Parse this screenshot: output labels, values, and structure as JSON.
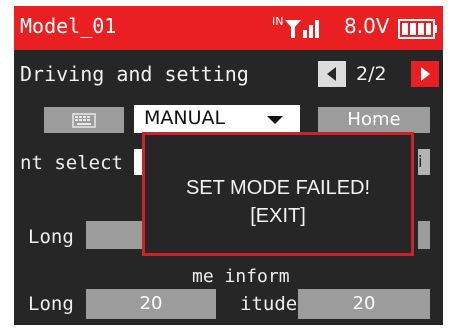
{
  "status_bar": {
    "model_name": "Model_01",
    "signal_prefix": "IN",
    "voltage": "8.0V",
    "signal_icon": "signal-bars-icon",
    "battery_icon": "battery-icon"
  },
  "header": {
    "title": "Driving and setting",
    "page": "2/2",
    "prev_icon": "arrow-left-icon",
    "next_icon": "arrow-right-icon"
  },
  "controls": {
    "keyboard_icon": "keyboard-icon",
    "mode_value": "MANUAL",
    "home_label": "Home",
    "select_label": "nt select",
    "right_strip_text": "i"
  },
  "fields": {
    "long1_label": "Long",
    "info_text": "me inform",
    "long2_label": "Long",
    "long2_value": "20",
    "lat_label": "itude",
    "lat_value": "20"
  },
  "dialog": {
    "message": "SET MODE FAILED!",
    "exit_label": "[EXIT]"
  },
  "colors": {
    "accent": "#ea1f22",
    "background": "#262626",
    "field_gray": "#9c9c9c",
    "dialog_border": "#c8242a"
  }
}
